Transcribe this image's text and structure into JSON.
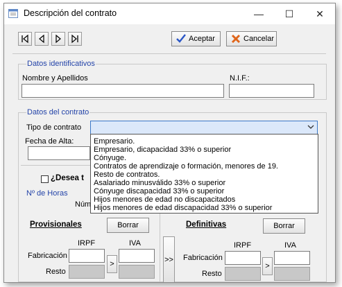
{
  "window": {
    "title": "Descripción del contrato",
    "minimize_glyph": "—",
    "maximize_glyph": "☐",
    "close_glyph": "✕"
  },
  "toolbar": {
    "nav_icons": [
      "first-record-icon",
      "previous-record-icon",
      "next-record-icon",
      "last-record-icon"
    ],
    "accept_label": "Aceptar",
    "cancel_label": "Cancelar",
    "accept_icon": "checkmark-icon",
    "cancel_icon": "cross-icon"
  },
  "datos_identificativos": {
    "title": "Datos identificativos",
    "nombre_label": "Nombre y Apellidos",
    "nombre_value": "",
    "nif_label": "N.I.F.:",
    "nif_value": ""
  },
  "datos_contrato": {
    "title": "Datos del contrato",
    "tipo_label": "Tipo de contrato",
    "tipo_value": "",
    "fecha_label": "Fecha de Alta:",
    "fecha_value": "",
    "desea_label": "¿Desea t",
    "horas_label": "Nº de Horas",
    "num_label": "Núm"
  },
  "tipo_options": [
    "Empresario.",
    "Empresario, dicapacidad 33% o superior",
    "Cónyuge.",
    "Contratos de aprendizaje o formación, menores de 19.",
    "Resto de contratos.",
    "Asalariado minusválido 33% o superior",
    "Cónyuge discapacidad 33% o superior",
    "Hijos menores de edad no discapacitados",
    "Hijos menores de edad discapacidad 33% o superior"
  ],
  "provisionales": {
    "title": "Provisionales",
    "borrar_label": "Borrar",
    "irpf_label": "IRPF",
    "iva_label": "IVA",
    "fabricacion_label": "Fabricación",
    "resto_label": "Resto",
    "copy_label": ">"
  },
  "transfer_label": ">>",
  "definitivas": {
    "title": "Definitivas",
    "borrar_label": "Borrar",
    "irpf_label": "IRPF",
    "iva_label": "IVA",
    "fabricacion_label": "Fabricación",
    "resto_label": "Resto",
    "copy_label": ">"
  },
  "colors": {
    "group_title": "#2343a8",
    "combo_fill": "#dbe8fa",
    "combo_border": "#3a78c9",
    "dialog_bg": "#f0f0f0"
  }
}
